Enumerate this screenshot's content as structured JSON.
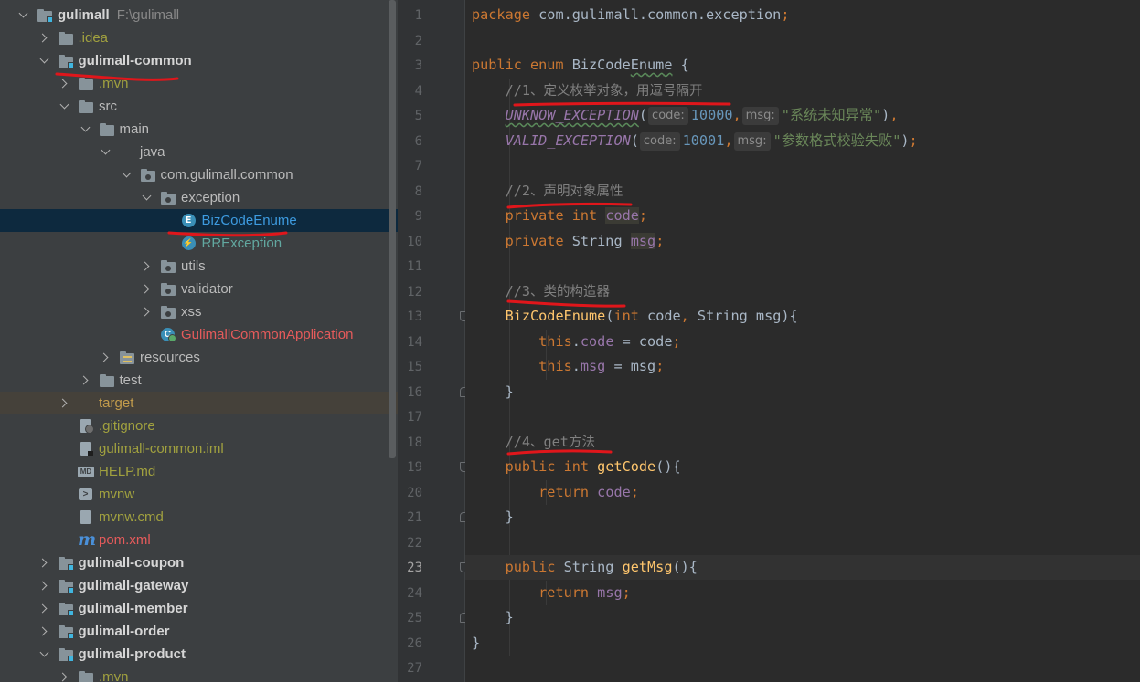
{
  "tree": {
    "rows": [
      {
        "label": "gulimall",
        "extra": "F:\\gulimall",
        "icon": "module",
        "arrow": "down",
        "indent": 0,
        "style": "t-bold"
      },
      {
        "label": ".idea",
        "icon": "folder",
        "arrow": "right",
        "indent": 1,
        "style": "t-olive"
      },
      {
        "label": "gulimall-common",
        "icon": "module",
        "arrow": "down",
        "indent": 1,
        "style": "t-bold"
      },
      {
        "label": ".mvn",
        "icon": "folder",
        "arrow": "right",
        "indent": 2,
        "style": "t-olive"
      },
      {
        "label": "src",
        "icon": "folder",
        "arrow": "down",
        "indent": 2,
        "style": ""
      },
      {
        "label": "main",
        "icon": "folder",
        "arrow": "down",
        "indent": 3,
        "style": ""
      },
      {
        "label": "java",
        "icon": "folder-blue",
        "arrow": "down",
        "indent": 4,
        "style": ""
      },
      {
        "label": "com.gulimall.common",
        "icon": "pkg",
        "arrow": "down",
        "indent": 5,
        "style": ""
      },
      {
        "label": "exception",
        "icon": "pkg",
        "arrow": "down",
        "indent": 6,
        "style": ""
      },
      {
        "label": "BizCodeEnume",
        "icon": "enum-c",
        "arrow": "",
        "indent": 7,
        "style": "t-blue",
        "selected": true
      },
      {
        "label": "RRException",
        "icon": "exc-c",
        "arrow": "",
        "indent": 7,
        "style": "t-green"
      },
      {
        "label": "utils",
        "icon": "pkg",
        "arrow": "right",
        "indent": 6,
        "style": ""
      },
      {
        "label": "validator",
        "icon": "pkg",
        "arrow": "right",
        "indent": 6,
        "style": ""
      },
      {
        "label": "xss",
        "icon": "pkg",
        "arrow": "right",
        "indent": 6,
        "style": ""
      },
      {
        "label": "GulimallCommonApplication",
        "icon": "app-c",
        "arrow": "",
        "indent": 6,
        "style": "t-red"
      },
      {
        "label": "resources",
        "icon": "res",
        "arrow": "right",
        "indent": 4,
        "style": ""
      },
      {
        "label": "test",
        "icon": "folder",
        "arrow": "right",
        "indent": 3,
        "style": ""
      },
      {
        "label": "target",
        "icon": "folder-orange",
        "arrow": "right",
        "indent": 2,
        "style": "t-orange",
        "excluded": true
      },
      {
        "label": ".gitignore",
        "icon": "file git",
        "arrow": "",
        "indent": 2,
        "style": "t-olive"
      },
      {
        "label": "gulimall-common.iml",
        "icon": "file iml",
        "arrow": "",
        "indent": 2,
        "style": "t-olive"
      },
      {
        "label": "HELP.md",
        "icon": "md",
        "arrow": "",
        "indent": 2,
        "style": "t-olive"
      },
      {
        "label": "mvnw",
        "icon": "term",
        "arrow": "",
        "indent": 2,
        "style": "t-olive"
      },
      {
        "label": "mvnw.cmd",
        "icon": "cmd",
        "arrow": "",
        "indent": 2,
        "style": "t-olive"
      },
      {
        "label": "pom.xml",
        "icon": "maven",
        "arrow": "",
        "indent": 2,
        "style": "t-red"
      },
      {
        "label": "gulimall-coupon",
        "icon": "module",
        "arrow": "right",
        "indent": 1,
        "style": "t-bold"
      },
      {
        "label": "gulimall-gateway",
        "icon": "module",
        "arrow": "right",
        "indent": 1,
        "style": "t-bold"
      },
      {
        "label": "gulimall-member",
        "icon": "module",
        "arrow": "right",
        "indent": 1,
        "style": "t-bold"
      },
      {
        "label": "gulimall-order",
        "icon": "module",
        "arrow": "right",
        "indent": 1,
        "style": "t-bold"
      },
      {
        "label": "gulimall-product",
        "icon": "module",
        "arrow": "down",
        "indent": 1,
        "style": "t-bold"
      },
      {
        "label": ".mvn",
        "icon": "folder",
        "arrow": "right",
        "indent": 2,
        "style": "t-olive"
      }
    ]
  },
  "editor": {
    "current_line": 23,
    "lines": [
      [
        [
          "kw",
          "package "
        ],
        [
          "cls",
          "com.gulimall.common.exception"
        ],
        [
          "kw",
          ";"
        ]
      ],
      [],
      [
        [
          "kw",
          "public enum "
        ],
        [
          "cls",
          "BizCode"
        ],
        [
          "cls squig",
          "Enume"
        ],
        [
          "cls",
          " {"
        ]
      ],
      [
        [
          "cls",
          "    "
        ],
        [
          "cm",
          "//1"
        ],
        [
          "cmz",
          "、定义枚举对象，用逗号隔开"
        ]
      ],
      [
        [
          "cls",
          "    "
        ],
        [
          "fld-it squig",
          "UNKNOW_EXCEPTION"
        ],
        [
          "cls",
          "("
        ],
        [
          "hint",
          "code:"
        ],
        [
          "num",
          "10000"
        ],
        [
          "kw",
          ","
        ],
        [
          "hint",
          "msg:"
        ],
        [
          "str",
          "\"系统未知异常\""
        ],
        [
          "cls",
          ")"
        ],
        [
          "kw",
          ","
        ]
      ],
      [
        [
          "cls",
          "    "
        ],
        [
          "fld-it",
          "VALID_EXCEPTION"
        ],
        [
          "cls",
          "("
        ],
        [
          "hint",
          "code:"
        ],
        [
          "num",
          "10001"
        ],
        [
          "kw",
          ","
        ],
        [
          "hint",
          "msg:"
        ],
        [
          "str",
          "\"参数格式校验失败\""
        ],
        [
          "cls",
          ")"
        ],
        [
          "kw",
          ";"
        ]
      ],
      [],
      [
        [
          "cls",
          "    "
        ],
        [
          "cm",
          "//2"
        ],
        [
          "cmz",
          "、声明对象属性"
        ]
      ],
      [
        [
          "cls",
          "    "
        ],
        [
          "kw",
          "private int "
        ],
        [
          "fld hl",
          "code"
        ],
        [
          "kw",
          ";"
        ]
      ],
      [
        [
          "cls",
          "    "
        ],
        [
          "kw",
          "private "
        ],
        [
          "cls",
          "String "
        ],
        [
          "fld hl",
          "msg"
        ],
        [
          "kw",
          ";"
        ]
      ],
      [],
      [
        [
          "cls",
          "    "
        ],
        [
          "cm",
          "//3"
        ],
        [
          "cmz",
          "、类的构造器"
        ]
      ],
      [
        [
          "cls",
          "    "
        ],
        [
          "meth",
          "BizCodeEnume"
        ],
        [
          "cls",
          "("
        ],
        [
          "kw",
          "int "
        ],
        [
          "cls",
          "code"
        ],
        [
          "kw",
          ", "
        ],
        [
          "cls",
          "String msg){"
        ]
      ],
      [
        [
          "cls",
          "        "
        ],
        [
          "kw",
          "this"
        ],
        [
          "cls",
          "."
        ],
        [
          "fld",
          "code"
        ],
        [
          "cls",
          " = code"
        ],
        [
          "kw",
          ";"
        ]
      ],
      [
        [
          "cls",
          "        "
        ],
        [
          "kw",
          "this"
        ],
        [
          "cls",
          "."
        ],
        [
          "fld",
          "msg"
        ],
        [
          "cls",
          " = msg"
        ],
        [
          "kw",
          ";"
        ]
      ],
      [
        [
          "cls",
          "    }"
        ]
      ],
      [],
      [
        [
          "cls",
          "    "
        ],
        [
          "cm",
          "//4"
        ],
        [
          "cmz",
          "、"
        ],
        [
          "cm",
          "get"
        ],
        [
          "cmz",
          "方法"
        ]
      ],
      [
        [
          "cls",
          "    "
        ],
        [
          "kw",
          "public int "
        ],
        [
          "meth",
          "getCode"
        ],
        [
          "cls",
          "(){"
        ]
      ],
      [
        [
          "cls",
          "        "
        ],
        [
          "kw",
          "return "
        ],
        [
          "fld",
          "code"
        ],
        [
          "kw",
          ";"
        ]
      ],
      [
        [
          "cls",
          "    }"
        ]
      ],
      [],
      [
        [
          "cls",
          "    "
        ],
        [
          "kw",
          "public "
        ],
        [
          "cls",
          "String "
        ],
        [
          "meth",
          "getMsg"
        ],
        [
          "cls",
          "(){"
        ]
      ],
      [
        [
          "cls",
          "        "
        ],
        [
          "kw",
          "return "
        ],
        [
          "fld",
          "msg"
        ],
        [
          "kw",
          ";"
        ]
      ],
      [
        [
          "cls",
          "    }"
        ]
      ],
      [
        [
          "cls",
          "}"
        ]
      ],
      []
    ]
  },
  "colors": {
    "annotation": "#e0161b",
    "tree_bg": "#3c3f41",
    "editor_bg": "#2b2b2b"
  }
}
